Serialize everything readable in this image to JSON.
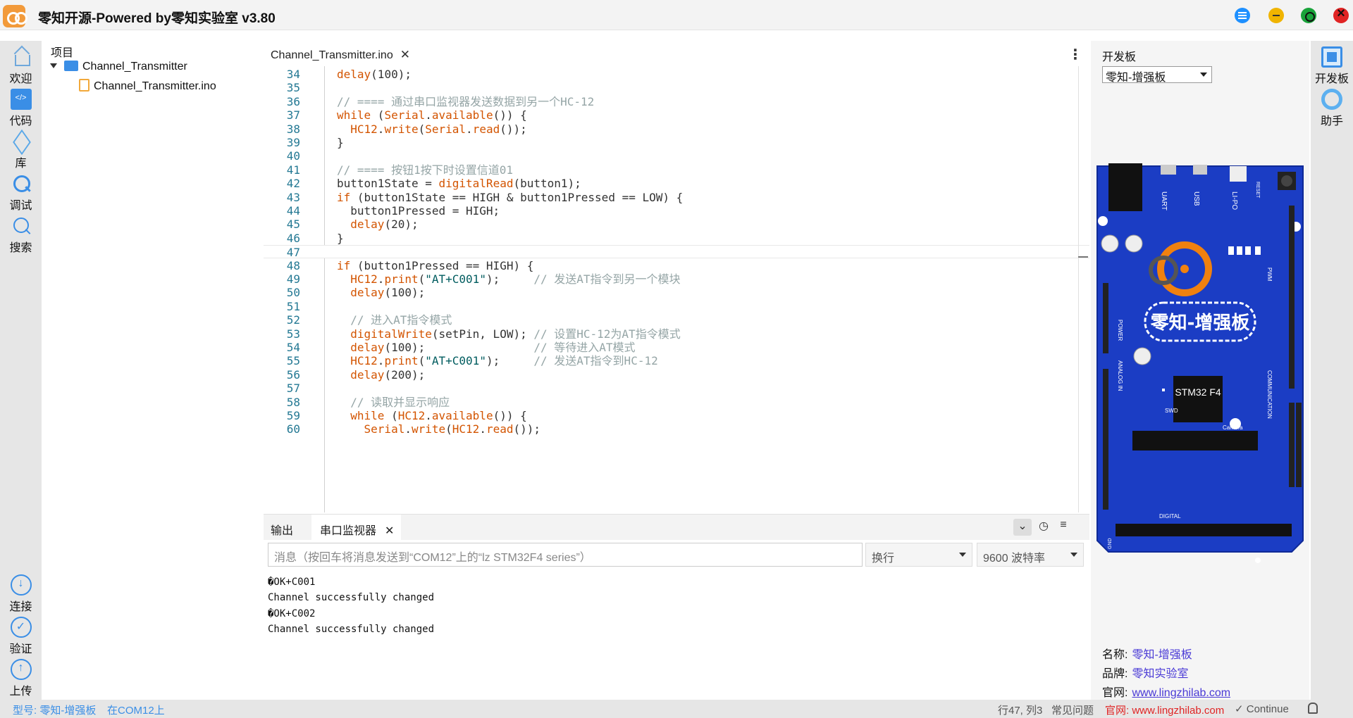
{
  "window": {
    "title": "零知开源-Powered by零知实验室 v3.80"
  },
  "left_sidebar": {
    "items": [
      {
        "label": "欢迎",
        "icon": "home-icon"
      },
      {
        "label": "代码",
        "icon": "code-icon"
      },
      {
        "label": "库",
        "icon": "cube-icon"
      },
      {
        "label": "调试",
        "icon": "debug-icon"
      },
      {
        "label": "搜索",
        "icon": "search-icon"
      }
    ],
    "bottom_items": [
      {
        "label": "连接",
        "icon": "connect-icon"
      },
      {
        "label": "验证",
        "icon": "verify-icon"
      },
      {
        "label": "上传",
        "icon": "upload-icon"
      }
    ]
  },
  "project_tree": {
    "header": "项目",
    "folder": "Channel_Transmitter",
    "file": "Channel_Transmitter.ino"
  },
  "editor": {
    "tab_label": "Channel_Transmitter.ino",
    "current_line": 47,
    "lines": [
      {
        "n": "34",
        "html": "<span class='f'>delay</span>(100);"
      },
      {
        "n": "35",
        "html": ""
      },
      {
        "n": "36",
        "html": "<span class='c'>// ==== 通过串口监视器发送数据到另一个HC-12</span>"
      },
      {
        "n": "37",
        "html": "<span class='k'>while</span> (<span class='f'>Serial</span>.<span class='f'>available</span>()) {"
      },
      {
        "n": "38",
        "html": "  <span class='f'>HC12</span>.<span class='f'>write</span>(<span class='f'>Serial</span>.<span class='f'>read</span>());"
      },
      {
        "n": "39",
        "html": "}"
      },
      {
        "n": "40",
        "html": ""
      },
      {
        "n": "41",
        "html": "<span class='c'>// ==== 按钮1按下时设置信道01</span>"
      },
      {
        "n": "42",
        "html": "button1State = <span class='f'>digitalRead</span>(button1);"
      },
      {
        "n": "43",
        "html": "<span class='k'>if</span> (button1State == HIGH &amp; button1Pressed == LOW) {"
      },
      {
        "n": "44",
        "html": "  button1Pressed = HIGH;"
      },
      {
        "n": "45",
        "html": "  <span class='f'>delay</span>(20);"
      },
      {
        "n": "46",
        "html": "}"
      },
      {
        "n": "47",
        "html": ""
      },
      {
        "n": "48",
        "html": "<span class='k'>if</span> (button1Pressed == HIGH) {"
      },
      {
        "n": "49",
        "html": "  <span class='f'>HC12</span>.<span class='f'>print</span>(<span class='s'>\"AT+C001\"</span>);     <span class='c'>// 发送AT指令到另一个模块</span>"
      },
      {
        "n": "50",
        "html": "  <span class='f'>delay</span>(100);"
      },
      {
        "n": "51",
        "html": ""
      },
      {
        "n": "52",
        "html": "  <span class='c'>// 进入AT指令模式</span>"
      },
      {
        "n": "53",
        "html": "  <span class='f'>digitalWrite</span>(setPin, LOW); <span class='c'>// 设置HC-12为AT指令模式</span>"
      },
      {
        "n": "54",
        "html": "  <span class='f'>delay</span>(100);                <span class='c'>// 等待进入AT模式</span>"
      },
      {
        "n": "55",
        "html": "  <span class='f'>HC12</span>.<span class='f'>print</span>(<span class='s'>\"AT+C001\"</span>);     <span class='c'>// 发送AT指令到HC-12</span>"
      },
      {
        "n": "56",
        "html": "  <span class='f'>delay</span>(200);"
      },
      {
        "n": "57",
        "html": ""
      },
      {
        "n": "58",
        "html": "  <span class='c'>// 读取并显示响应</span>"
      },
      {
        "n": "59",
        "html": "  <span class='k'>while</span> (<span class='f'>HC12</span>.<span class='f'>available</span>()) {"
      },
      {
        "n": "60",
        "html": "    <span class='f'>Serial</span>.<span class='f'>write</span>(<span class='f'>HC12</span>.<span class='f'>read</span>());"
      }
    ]
  },
  "bottom_panel": {
    "tabs": [
      "输出",
      "串口监视器"
    ],
    "active_tab": "串口监视器",
    "message_placeholder": "消息（按回车将消息发送到“COM12”上的“lz STM32F4 series”）",
    "line_ending": "换行",
    "baud_rate": "9600 波特率",
    "serial_output": [
      "�OK+C001",
      "Channel successfully changed",
      "�OK+C002",
      "Channel successfully changed"
    ]
  },
  "board_panel": {
    "title": "开发板",
    "selected_board": "零知-增强板",
    "board_image_label": "零知-增强板",
    "chip_label": "STM32 F4",
    "silkscreen": {
      "uart": "UART",
      "usb": "USB",
      "lipo": "LI-PO",
      "reset": "RESET",
      "power": "POWER",
      "analog_in": "ANALOG IN",
      "pwm": "PWM",
      "communication": "COMMUNICATION",
      "digital": "DIGITAL",
      "swd": "SWD",
      "camera": "Camera",
      "gnd": "GND"
    },
    "info": {
      "name_label": "名称:",
      "name_value": "零知-增强板",
      "brand_label": "品牌:",
      "brand_value": "零知实验室",
      "site_label": "官网:",
      "site_value": "www.lingzhilab.com"
    }
  },
  "right_sidebar": {
    "items": [
      {
        "label": "开发板",
        "icon": "board-icon"
      },
      {
        "label": "助手",
        "icon": "assistant-icon"
      }
    ]
  },
  "status_bar": {
    "board": "型号: 零知-增强板",
    "port": "在COM12上",
    "position": "行47, 列3",
    "faq": "常见问题",
    "website": "官网: www.lingzhilab.com",
    "continue": "✓ Continue"
  },
  "colors": {
    "accent": "#3a8ee6",
    "board_blue": "#1b3dc4",
    "link": "#4a3ad6",
    "status_red": "#e02424"
  }
}
